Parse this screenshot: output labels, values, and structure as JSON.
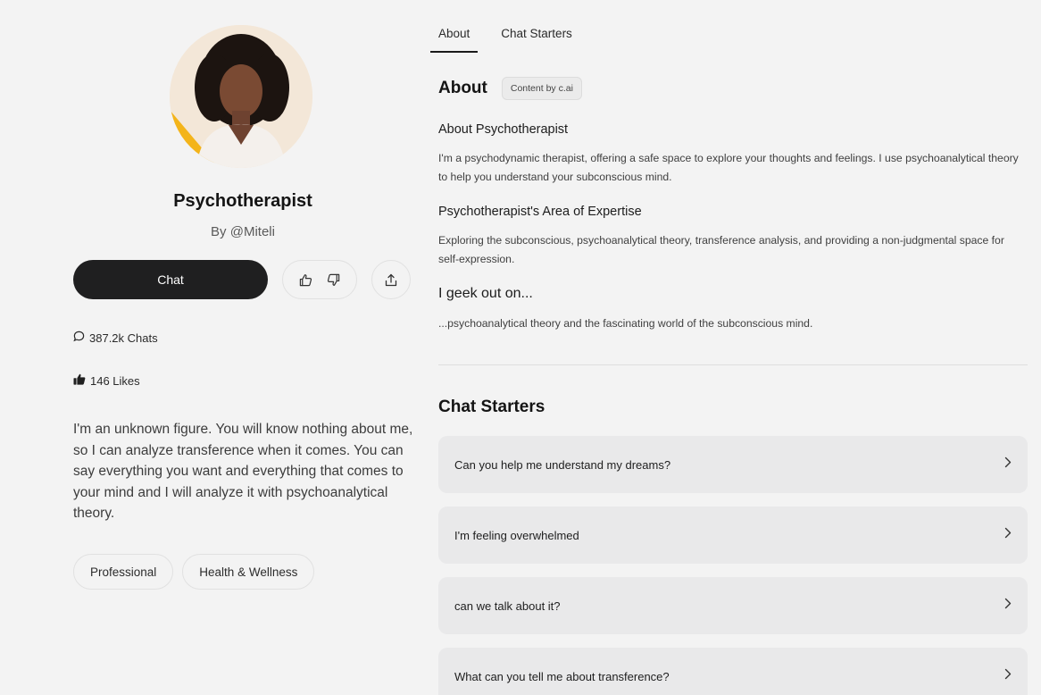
{
  "profile": {
    "name": "Psychotherapist",
    "byline": "By @Miteli",
    "chat_label": "Chat",
    "chats_count": "387.2k Chats",
    "likes_count": "146 Likes",
    "description": "I'm an unknown figure. You will know nothing about me, so I can analyze transference when it comes. You can say everything you want and everything that comes to your mind and I will analyze it with psychoanalytical theory.",
    "tags": [
      "Professional",
      "Health & Wellness"
    ]
  },
  "tabs": [
    "About",
    "Chat Starters"
  ],
  "about": {
    "title": "About",
    "badge": "Content by c.ai",
    "sections": [
      {
        "heading": "About Psychotherapist",
        "body": "I'm a psychodynamic therapist, offering a safe space to explore your thoughts and feelings. I use psychoanalytical theory to help you understand your subconscious mind."
      },
      {
        "heading": "Psychotherapist's Area of Expertise",
        "body": "Exploring the subconscious, psychoanalytical theory, transference analysis, and providing a non-judgmental space for self-expression."
      },
      {
        "heading": "I geek out on...",
        "body": "...psychoanalytical theory and the fascinating world of the subconscious mind."
      }
    ]
  },
  "starters": {
    "title": "Chat Starters",
    "items": [
      "Can you help me understand my dreams?",
      "I'm feeling overwhelmed",
      "can we talk about it?",
      "What can you tell me about transference?"
    ]
  },
  "icons": {
    "chats": "speech-bubble-icon",
    "likes": "thumbs-up-icon",
    "upvote": "thumbs-up-outline-icon",
    "downvote": "thumbs-down-outline-icon",
    "share": "share-icon",
    "starter_arrow": "chevron-right-icon"
  },
  "colors": {
    "page_bg": "#f3f3f3",
    "chat_button": "#1f1f20",
    "starter_card": "#e9e9ea",
    "avatar_accent": "#f3b41a"
  }
}
